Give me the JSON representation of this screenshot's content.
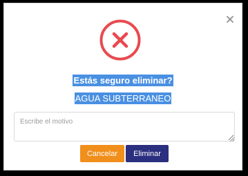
{
  "dialog": {
    "close_symbol": "×",
    "icon": "error-x-circle-icon",
    "question": "Estás seguro eliminar?",
    "item_name": "AGUA SUBTERRANEO",
    "reason_placeholder": "Escribe el motivo",
    "reason_value": "",
    "cancel_label": "Cancelar",
    "delete_label": "Eliminar"
  },
  "colors": {
    "error_red": "#e84a4f",
    "highlight_blue": "#4a90e2",
    "cancel_orange": "#f18f1c",
    "delete_navy": "#2b2f7f"
  }
}
